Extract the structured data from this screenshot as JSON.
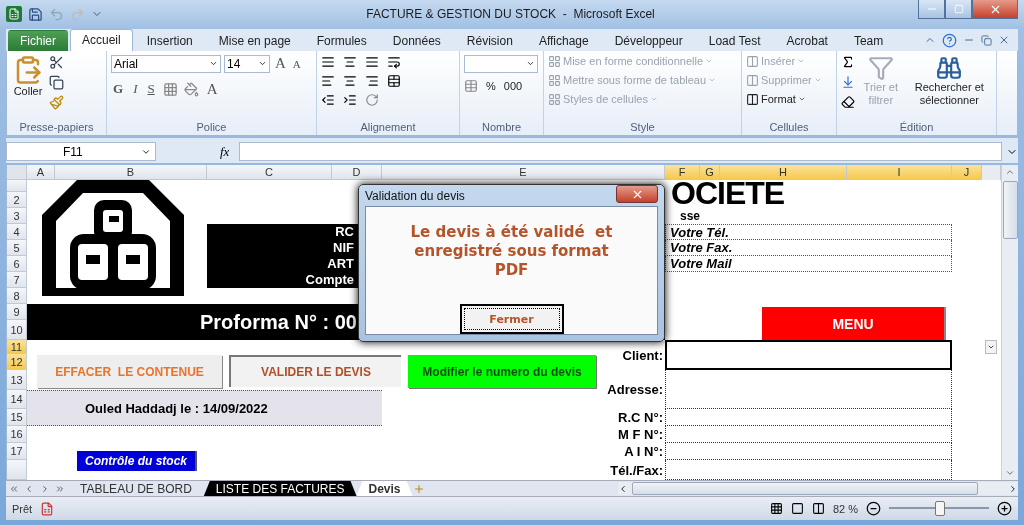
{
  "window": {
    "title": "FACTURE & GESTION DU STOCK  -  Microsoft Excel"
  },
  "ribbon_tabs": [
    {
      "label": "Fichier",
      "kind": "file",
      "selected": false
    },
    {
      "label": "Accueil",
      "kind": "tab",
      "selected": true
    },
    {
      "label": "Insertion",
      "kind": "tab",
      "selected": false
    },
    {
      "label": "Mise en page",
      "kind": "tab",
      "selected": false
    },
    {
      "label": "Formules",
      "kind": "tab",
      "selected": false
    },
    {
      "label": "Données",
      "kind": "tab",
      "selected": false
    },
    {
      "label": "Révision",
      "kind": "tab",
      "selected": false
    },
    {
      "label": "Affichage",
      "kind": "tab",
      "selected": false
    },
    {
      "label": "Développeur",
      "kind": "tab",
      "selected": false
    },
    {
      "label": "Load Test",
      "kind": "tab",
      "selected": false
    },
    {
      "label": "Acrobat",
      "kind": "tab",
      "selected": false
    },
    {
      "label": "Team",
      "kind": "tab",
      "selected": false
    }
  ],
  "ribbon": {
    "clipboard": {
      "label": "Presse-papiers",
      "paste": "Coller"
    },
    "font": {
      "label": "Police",
      "font_name": "Arial",
      "font_size": "14",
      "grow": "A",
      "shrink": "A",
      "bold": "G",
      "italic": "I",
      "underline": "S",
      "font_color": "A"
    },
    "alignment": {
      "label": "Alignement"
    },
    "number": {
      "label": "Nombre",
      "percent": "%",
      "thousands": "000"
    },
    "style": {
      "label": "Style",
      "items": [
        {
          "label": "Mise en forme conditionnelle",
          "disabled": true
        },
        {
          "label": "Mettre sous forme de tableau",
          "disabled": true
        },
        {
          "label": "Styles de cellules",
          "disabled": true
        }
      ]
    },
    "cells": {
      "label": "Cellules",
      "items": [
        {
          "label": "Insérer",
          "disabled": true
        },
        {
          "label": "Supprimer",
          "disabled": true
        },
        {
          "label": "Format",
          "disabled": false
        }
      ]
    },
    "editing": {
      "label": "Édition",
      "sort": {
        "label": "Trier et filtrer",
        "disabled": true
      },
      "find": {
        "label": "Rechercher et sélectionner",
        "disabled": false
      }
    }
  },
  "formula_bar": {
    "name_box": "F11",
    "function_label": "fx"
  },
  "columns": [
    {
      "label": "A",
      "selected": false
    },
    {
      "label": "B",
      "selected": false
    },
    {
      "label": "C",
      "selected": false
    },
    {
      "label": "D",
      "selected": false
    },
    {
      "label": "E",
      "selected": false
    },
    {
      "label": "F",
      "selected": true
    },
    {
      "label": "G",
      "selected": true
    },
    {
      "label": "H",
      "selected": true
    },
    {
      "label": "I",
      "selected": true
    },
    {
      "label": "J",
      "selected": true
    }
  ],
  "rows": [
    {
      "label": "2",
      "selected": false
    },
    {
      "label": "3",
      "selected": false
    },
    {
      "label": "4",
      "selected": false
    },
    {
      "label": "5",
      "selected": false
    },
    {
      "label": "6",
      "selected": false
    },
    {
      "label": "7",
      "selected": false
    },
    {
      "label": "8",
      "selected": false
    },
    {
      "label": "9",
      "selected": false
    },
    {
      "label": "10",
      "selected": false
    },
    {
      "label": "11",
      "selected": true
    },
    {
      "label": "12",
      "selected": true
    },
    {
      "label": "13",
      "selected": false
    },
    {
      "label": "14",
      "selected": false
    },
    {
      "label": "15",
      "selected": false
    },
    {
      "label": "16",
      "selected": false
    },
    {
      "label": "17",
      "selected": false
    }
  ],
  "sheet": {
    "company_lines": [
      "RC",
      "NIF",
      "ART",
      "Compte"
    ],
    "title": "OCIETE",
    "address_fragment": "sse",
    "contact_lines": [
      "Votre Tél.",
      "Votre Fax.",
      "Votre Mail"
    ],
    "proforma": "Proforma N° : 00",
    "menu_button": "MENU",
    "actions": [
      {
        "label": "EFFACER  LE CONTENUE",
        "kind": "clear"
      },
      {
        "label": "VALIDER LE DEVIS",
        "kind": "validate"
      },
      {
        "label": "Modifier le numero du devis",
        "kind": "renumber"
      }
    ],
    "date_line": "Ouled Haddadj le : 14/09/2022",
    "client_fields": [
      {
        "label": "Client:",
        "selected": true
      },
      {
        "label": "Adresse:",
        "selected": false
      },
      {
        "label": "R.C N°:",
        "selected": false
      },
      {
        "label": "M F N°:",
        "selected": false
      },
      {
        "label": "A I N°:",
        "selected": false
      },
      {
        "label": "Tél./Fax:",
        "selected": false
      }
    ],
    "stock_button": "Contrôle du stock"
  },
  "dialog": {
    "title": "Validation du devis",
    "message": "Le devis à été validé  et enregistré sous format PDF",
    "button": "Fermer"
  },
  "sheet_tabs": [
    {
      "label": "TABLEAU DE BORD",
      "selected": false
    },
    {
      "label": "LISTE DES FACTURES",
      "selected": false,
      "color": "#000000"
    },
    {
      "label": "Devis",
      "selected": true
    }
  ],
  "status_bar": {
    "status": "Prêt",
    "zoom": "82 %",
    "zoom_slider": {
      "level": 0.5
    }
  }
}
